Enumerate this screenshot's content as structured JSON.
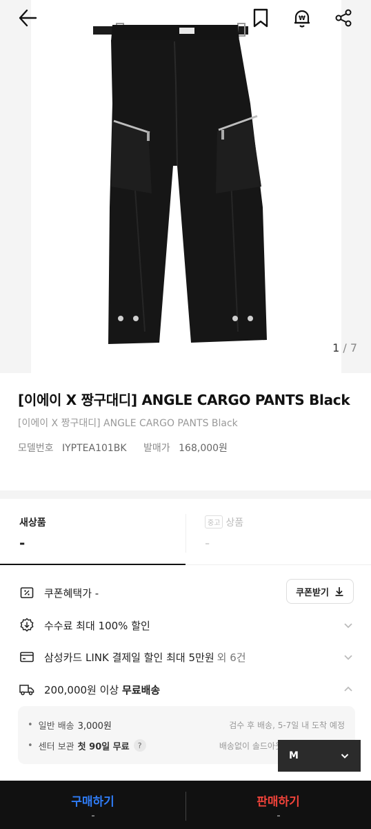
{
  "image": {
    "counter_current": "1",
    "counter_sep": " / ",
    "counter_total": "7"
  },
  "topbar": {
    "back_icon": "arrow-left-icon",
    "bookmark_icon": "bookmark-icon",
    "price_alert_icon": "won-bell-icon",
    "share_icon": "share-icon"
  },
  "product": {
    "title": "[이에이 X 짱구대디] ANGLE CARGO PANTS Black",
    "subtitle": "[이에이 X 짱구대디] ANGLE CARGO PANTS Black",
    "model_label": "모델번호",
    "model_value": "IYPTEA101BK",
    "release_label": "발매가",
    "release_value": "168,000원"
  },
  "tabs": {
    "new_label": "새상품",
    "new_price": "-",
    "used_chip": "중고",
    "used_label": "상품",
    "used_price": "-"
  },
  "benefits": {
    "coupon_label": "쿠폰혜택가 -",
    "coupon_button": "쿠폰받기",
    "fee_label": "수수료 최대 100% 할인",
    "card_label": "삼성카드 LINK 결제일 할인 최대 5만원",
    "card_extra": "외 6건",
    "shipping_prefix": "200,000원 이상 ",
    "shipping_strong": "무료배송"
  },
  "shipping": {
    "standard_label": "일반 배송",
    "standard_price": "3,000원",
    "standard_note": "검수 후 배송, 5-7일 내 도착 예정",
    "center_label": "센터 보관",
    "center_strong": "첫 90일 무료",
    "center_help": "?",
    "center_note": "배송없이 솔드아웃"
  },
  "size": {
    "selected": "M"
  },
  "bottom": {
    "buy": "구매하기",
    "sell": "판매하기"
  },
  "colors": {
    "buy": "#2f7cf6",
    "sell": "#f0433a",
    "bottom_bg": "#111111"
  }
}
